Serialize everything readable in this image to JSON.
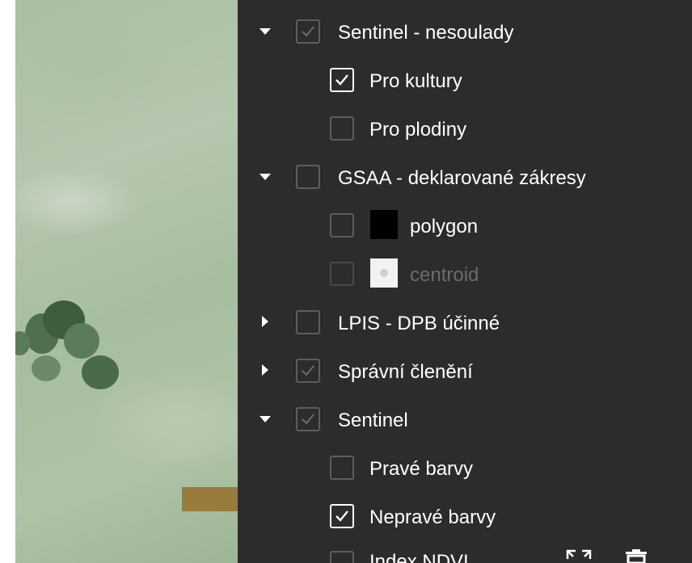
{
  "layers": {
    "sentinel_nesoulady": {
      "label": "Sentinel - nesoulady",
      "expanded": true,
      "checked": true,
      "checkbox_state": "disabled-checked"
    },
    "pro_kultury": {
      "label": "Pro kultury",
      "checked": true
    },
    "pro_plodiny": {
      "label": "Pro plodiny",
      "checked": false
    },
    "gsaa": {
      "label": "GSAA - deklarované zákresy",
      "expanded": true,
      "checked": false
    },
    "polygon": {
      "label": "polygon",
      "checked": false,
      "swatch_color": "#000000"
    },
    "centroid": {
      "label": "centroid",
      "checked": false,
      "disabled": true,
      "swatch_color": "#f2f2f2"
    },
    "lpis": {
      "label": "LPIS - DPB účinné",
      "expanded": false,
      "checked": false
    },
    "spravni_cleneni": {
      "label": "Správní členění",
      "expanded": false,
      "checked": true,
      "checkbox_state": "disabled-checked"
    },
    "sentinel": {
      "label": "Sentinel",
      "expanded": true,
      "checked": true,
      "checkbox_state": "disabled-checked"
    },
    "prave_barvy": {
      "label": "Pravé barvy",
      "checked": false
    },
    "neprave_barvy": {
      "label": "Nepravé barvy",
      "checked": true
    },
    "index_ndvi": {
      "label": "Index NDVI",
      "checked": false
    }
  },
  "toolbar": {
    "icons": [
      "expand-icon",
      "delete-icon"
    ]
  },
  "colors": {
    "panel_bg": "#2c2c2c",
    "text": "#ffffff",
    "muted_text": "#6b6b6b",
    "checkbox_border": "#5d5d5d"
  }
}
